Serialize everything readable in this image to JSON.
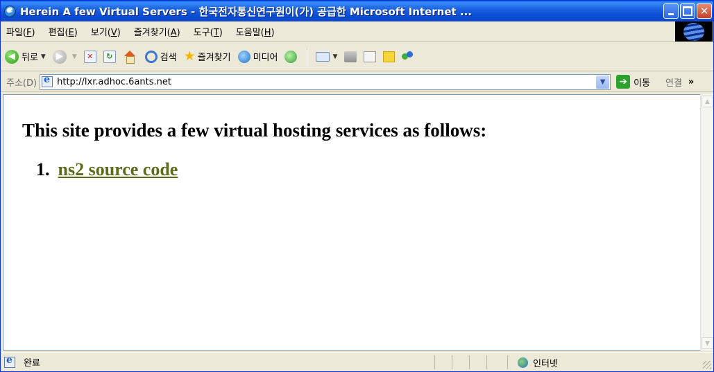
{
  "window": {
    "title": "Herein A few Virtual Servers - 한국전자통신연구원이(가) 공급한 Microsoft Internet ..."
  },
  "menu": {
    "items": [
      {
        "label": "파일(",
        "key": "F",
        "end": ")"
      },
      {
        "label": "편집(",
        "key": "E",
        "end": ")"
      },
      {
        "label": "보기(",
        "key": "V",
        "end": ")"
      },
      {
        "label": "즐겨찾기(",
        "key": "A",
        "end": ")"
      },
      {
        "label": "도구(",
        "key": "T",
        "end": ")"
      },
      {
        "label": "도움말(",
        "key": "H",
        "end": ")"
      }
    ]
  },
  "toolbar": {
    "back_label": "뒤로",
    "search_label": "검색",
    "favorites_label": "즐겨찾기",
    "media_label": "미디어"
  },
  "address": {
    "label": "주소(D)",
    "url": "http://lxr.adhoc.6ants.net",
    "go_label": "이동",
    "links_label": "연결",
    "chevron": "»"
  },
  "content": {
    "heading": "This site provides a few virtual hosting services as follows:",
    "list": [
      {
        "number": "1.",
        "link_text": "ns2 source code"
      }
    ]
  },
  "status": {
    "text": "완료",
    "zone": "인터넷"
  },
  "colors": {
    "title_bar": "#0b4ed6",
    "link": "#5c6b1c",
    "chrome": "#ece9d8"
  },
  "icons": [
    "ie-icon",
    "back-icon",
    "forward-icon",
    "stop-icon",
    "refresh-icon",
    "home-icon",
    "search-icon",
    "star-icon",
    "media-icon",
    "history-icon",
    "mail-icon",
    "print-icon",
    "edit-icon",
    "note-icon",
    "messenger-icon",
    "page-icon",
    "go-arrow-icon",
    "internet-zone-icon"
  ]
}
